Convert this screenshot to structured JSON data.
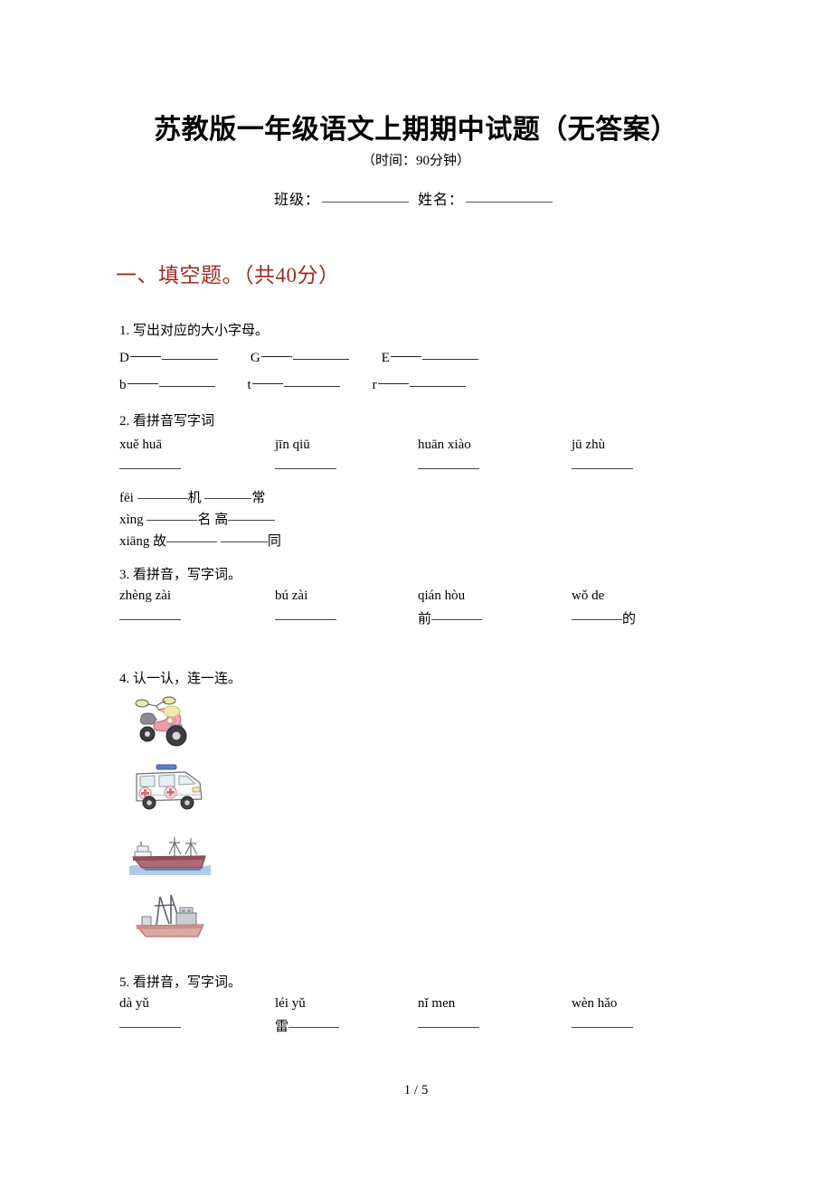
{
  "document": {
    "title": "苏教版一年级语文上期期中试题（无答案）",
    "subtitle": "（时间：90分钟）",
    "class_label": "班级：",
    "name_label": "姓名：",
    "footer": "1 / 5"
  },
  "section": {
    "heading": "一、填空题。（共40分）",
    "heading_color": "#9e2a22"
  },
  "questions": [
    {
      "number": "1.",
      "stem": "1. 写出对应的大小字母。",
      "row1": [
        "D",
        "G",
        "E"
      ],
      "row2": [
        "b",
        "t",
        "r"
      ]
    },
    {
      "number": "2.",
      "stem": "2. 看拼音写字词",
      "pinyin": [
        "xuě huā",
        "jīn qiū",
        "huān xiào",
        "jū zhù"
      ],
      "fill_rows": [
        {
          "pinyin": "fēi",
          "parts": [
            "机",
            "常"
          ]
        },
        {
          "pinyin": "xìng",
          "parts": [
            "名",
            "高"
          ]
        },
        {
          "pinyin": "xiāng",
          "parts": [
            "故",
            "同"
          ]
        }
      ]
    },
    {
      "number": "3.",
      "stem": "3. 看拼音，写字词。",
      "pinyin": [
        "zhèng zài",
        "bú zài",
        "qián hòu",
        "wǒ de"
      ],
      "hints": [
        "",
        "",
        "前",
        "的"
      ]
    },
    {
      "number": "4.",
      "stem": "4. 认一认，连一连。",
      "images": [
        {
          "name": "scooter",
          "label": "摩托车"
        },
        {
          "name": "ambulance",
          "label": "救护车"
        },
        {
          "name": "cargo-ship",
          "label": "轮船"
        },
        {
          "name": "fishing-boat",
          "label": "渔船"
        }
      ]
    },
    {
      "number": "5.",
      "stem": "5. 看拼音，写字词。",
      "pinyin": [
        "dà yǔ",
        "léi yǔ",
        "nǐ men",
        "wèn hǎo"
      ],
      "hints": [
        "",
        "雷",
        "",
        ""
      ]
    }
  ]
}
